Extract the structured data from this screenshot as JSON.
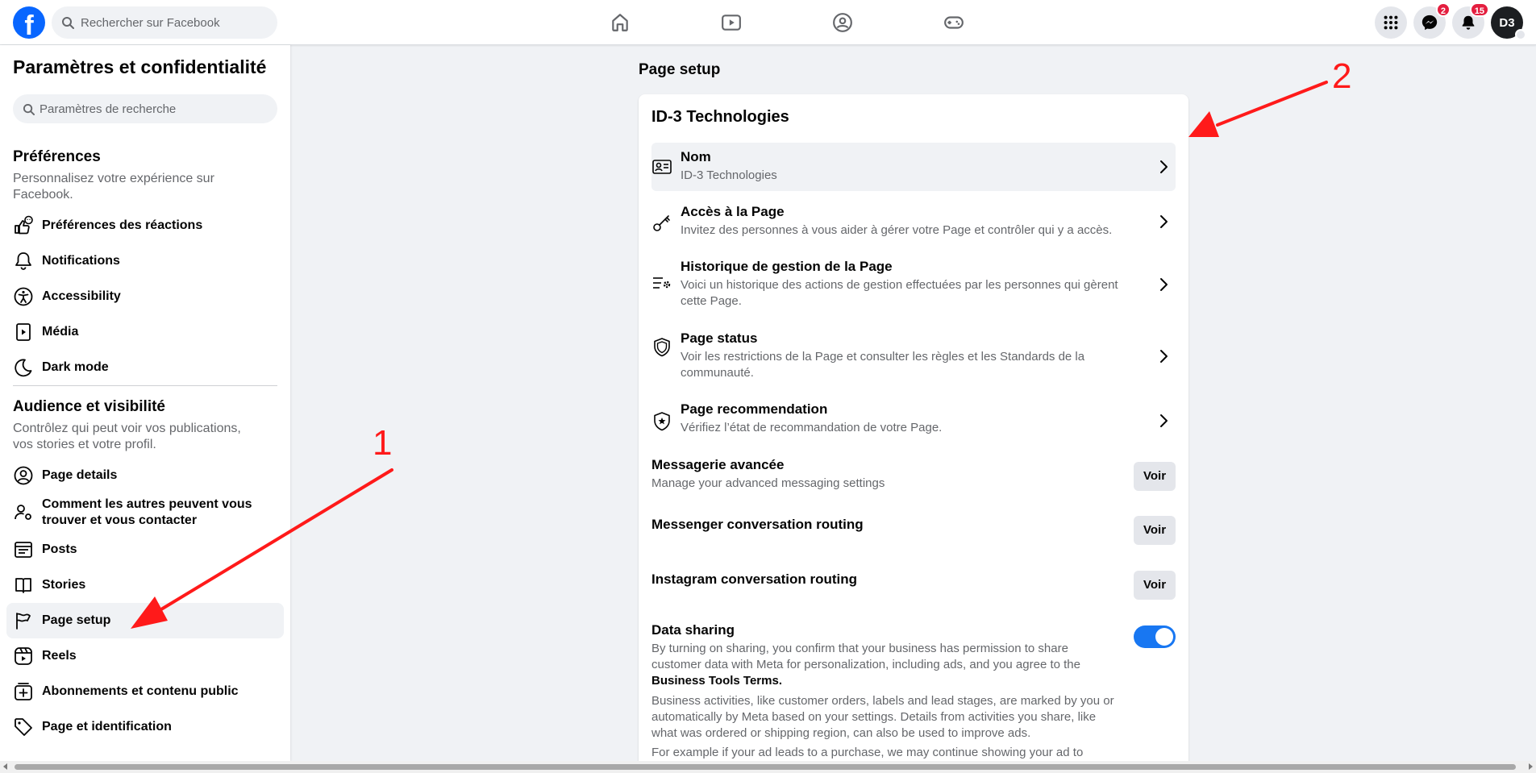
{
  "topbar": {
    "logo": "f",
    "search_placeholder": "Rechercher sur Facebook",
    "nav": [
      "home-icon",
      "video-icon",
      "groups-icon",
      "gaming-icon"
    ],
    "messenger_badge": "2",
    "notifications_badge": "15",
    "avatar_text": "D3"
  },
  "sidebar": {
    "title": "Paramètres et confidentialité",
    "search_placeholder": "Paramètres de recherche",
    "section1": {
      "title": "Préférences",
      "desc": "Personnalisez votre expérience sur Facebook.",
      "items": [
        {
          "label": "Préférences des réactions",
          "icon": "reactions-icon"
        },
        {
          "label": "Notifications",
          "icon": "bell-icon"
        },
        {
          "label": "Accessibility",
          "icon": "accessibility-icon"
        },
        {
          "label": "Média",
          "icon": "media-icon"
        },
        {
          "label": "Dark mode",
          "icon": "moon-icon"
        }
      ]
    },
    "section2": {
      "title": "Audience et visibilité",
      "desc": "Contrôlez qui peut voir vos publications, vos stories et votre profil.",
      "items": [
        {
          "label": "Page details",
          "icon": "user-circle-icon"
        },
        {
          "label": "Comment les autres peuvent vous trouver et vous contacter",
          "icon": "user-settings-icon"
        },
        {
          "label": "Posts",
          "icon": "posts-icon"
        },
        {
          "label": "Stories",
          "icon": "book-icon"
        },
        {
          "label": "Page setup",
          "icon": "flag-icon",
          "active": true
        },
        {
          "label": "Reels",
          "icon": "reels-icon"
        },
        {
          "label": "Abonnements et contenu public",
          "icon": "add-box-icon"
        },
        {
          "label": "Page et identification",
          "icon": "tag-icon"
        }
      ]
    }
  },
  "main": {
    "title": "Page setup",
    "card_title": "ID-3 Technologies",
    "rows": [
      {
        "label": "Nom",
        "sub": "ID-3 Technologies"
      },
      {
        "label": "Accès à la Page",
        "sub": "Invitez des personnes à vous aider à gérer votre Page et contrôler qui y a accès."
      },
      {
        "label": "Historique de gestion de la Page",
        "sub": "Voici un historique des actions de gestion effectuées par les personnes qui gèrent cette Page."
      },
      {
        "label": "Page status",
        "sub": "Voir les restrictions de la Page et consulter les règles et les Standards de la communauté."
      },
      {
        "label": "Page recommendation",
        "sub": "Vérifiez l’état de recommandation de votre Page."
      }
    ],
    "messagerie": {
      "label": "Messagerie avancée",
      "sub": "Manage your advanced messaging settings",
      "button": "Voir"
    },
    "messenger_routing": {
      "label": "Messenger conversation routing",
      "button": "Voir"
    },
    "instagram_routing": {
      "label": "Instagram conversation routing",
      "button": "Voir"
    },
    "data_sharing": {
      "label": "Data sharing",
      "text1": "By turning on sharing, you confirm that your business has permission to share customer data with Meta for personalization, including ads, and you agree to the ",
      "text1_bold": "Business Tools Terms.",
      "text2": "Business activities, like customer orders, labels and lead stages, are marked by you or automatically by Meta based on your settings. Details from activities you share, like what was ordered or shipping region, can also be used to improve ads.",
      "text3": "For example if your ad leads to a purchase, we may continue showing your ad to similar",
      "enabled": true
    }
  },
  "annotations": {
    "one": "1",
    "two": "2"
  },
  "colors": {
    "accent": "#1877f2",
    "brand": "#0866ff",
    "arrow": "#ff1a1a"
  }
}
